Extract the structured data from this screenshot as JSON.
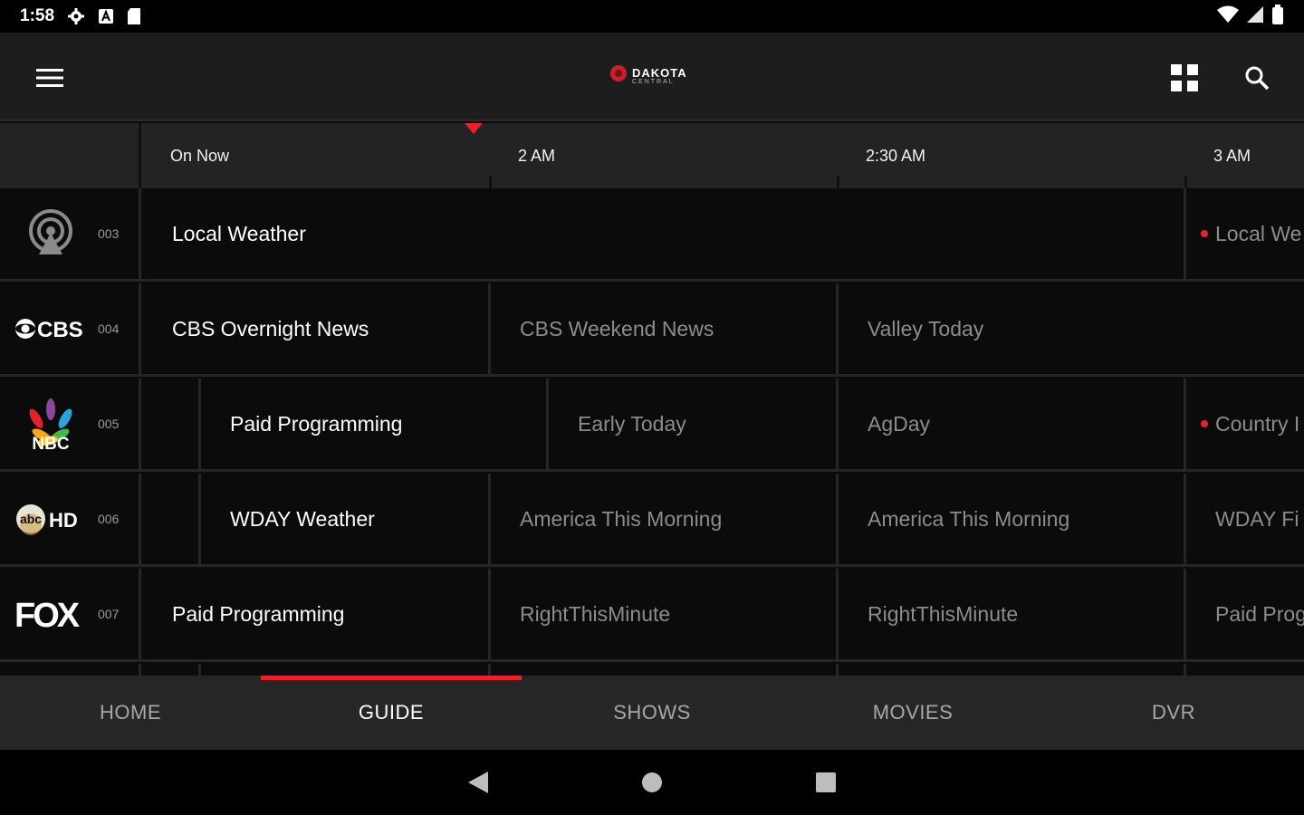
{
  "status_bar": {
    "time": "1:58",
    "icons": [
      "gear-icon",
      "a-box-icon",
      "sd-card-icon"
    ],
    "right_icons": [
      "wifi-icon",
      "signal-icon",
      "battery-icon"
    ]
  },
  "app_bar": {
    "menu_icon": "hamburger-menu-icon",
    "logo_main": "DAKOTA",
    "logo_sub": "CENTRAL",
    "grid_icon": "grid-view-icon",
    "search_icon": "search-icon"
  },
  "time_header": {
    "slots": [
      "On Now",
      "2 AM",
      "2:30 AM",
      "3 AM"
    ]
  },
  "colors": {
    "accent": "#e8212f",
    "background": "#0b0b0b",
    "app_bar": "#1d1d1d",
    "header": "#232323",
    "nav": "#262626"
  },
  "channels": [
    {
      "logo": "Local weather",
      "logo_icon": "antenna-tower-icon",
      "number": "003",
      "programs": [
        {
          "title": "Local Weather",
          "state": "now"
        },
        {
          "title": "Local We",
          "state": "later",
          "recording": true
        }
      ]
    },
    {
      "logo": "CBS",
      "logo_icon": "cbs-logo-icon",
      "number": "004",
      "programs": [
        {
          "title": "CBS Overnight News",
          "state": "now"
        },
        {
          "title": "CBS Weekend News",
          "state": "later"
        },
        {
          "title": "Valley Today",
          "state": "later"
        }
      ]
    },
    {
      "logo": "NBC",
      "logo_icon": "nbc-peacock-icon",
      "number": "005",
      "programs": [
        {
          "title": "",
          "state": "now"
        },
        {
          "title": "Paid Programming",
          "state": "now"
        },
        {
          "title": "Early Today",
          "state": "later"
        },
        {
          "title": "AgDay",
          "state": "later"
        },
        {
          "title": "Country I",
          "state": "later",
          "recording": true
        }
      ]
    },
    {
      "logo": "HD",
      "logo_icon": "abc-hd-logo-icon",
      "number": "006",
      "programs": [
        {
          "title": "",
          "state": "now"
        },
        {
          "title": "WDAY Weather",
          "state": "now"
        },
        {
          "title": "America This Morning",
          "state": "later"
        },
        {
          "title": "America This Morning",
          "state": "later"
        },
        {
          "title": "WDAY Fi",
          "state": "later"
        }
      ]
    },
    {
      "logo": "FOX",
      "logo_icon": "fox-logo-icon",
      "number": "007",
      "programs": [
        {
          "title": "Paid Programming",
          "state": "now"
        },
        {
          "title": "RightThisMinute",
          "state": "later"
        },
        {
          "title": "RightThisMinute",
          "state": "later"
        },
        {
          "title": "Paid Prog",
          "state": "later"
        }
      ]
    }
  ],
  "bottom_nav": {
    "tabs": [
      {
        "label": "HOME",
        "active": false
      },
      {
        "label": "GUIDE",
        "active": true
      },
      {
        "label": "SHOWS",
        "active": false
      },
      {
        "label": "MOVIES",
        "active": false
      },
      {
        "label": "DVR",
        "active": false
      }
    ]
  },
  "system_nav": {
    "back_icon": "back-triangle-icon",
    "home_icon": "home-circle-icon",
    "recents_icon": "recents-square-icon"
  }
}
